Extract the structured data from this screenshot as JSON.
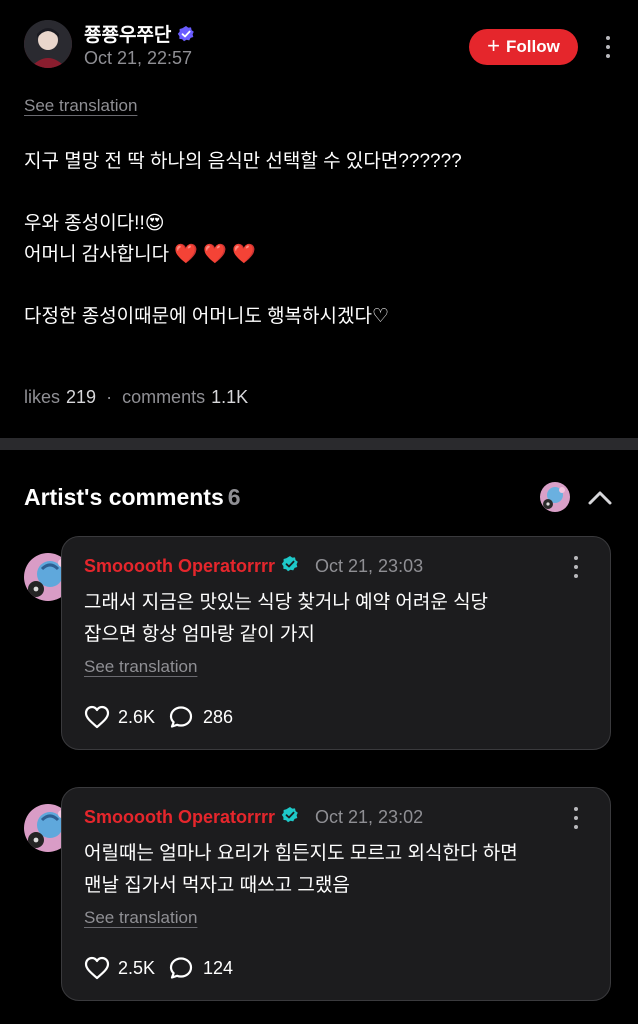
{
  "post": {
    "username": "쭁쭁우쭈단",
    "timestamp": "Oct 21, 22:57",
    "follow_label": "Follow",
    "see_translation": "See translation",
    "lines": [
      "지구 멸망 전 딱 하나의 음식만 선택할 수 있다면??????",
      "",
      "우와 종성이다!!😍",
      "어머니 감사합니다 ❤️ ❤️ ❤️",
      "",
      "다정한 종성이때문에 어머니도 행복하시겠다♡"
    ],
    "likes_label": "likes",
    "likes_count": "219",
    "separator": "·",
    "comments_label": "comments",
    "comments_count": "1.1K"
  },
  "artist_comments": {
    "title": "Artist's comments",
    "count": "6",
    "comments": [
      {
        "name": "Smooooth Operatorrrr",
        "time": "Oct 21, 23:03",
        "line1": "그래서 지금은 맛있는 식당 찾거나 예약 어려운 식당",
        "line2": "잡으면 항상 엄마랑 같이 가지",
        "see_translation": "See translation",
        "likes": "2.6K",
        "replies": "286"
      },
      {
        "name": "Smooooth Operatorrrr",
        "time": "Oct 21, 23:02",
        "line1": "어릴때는 얼마나 요리가 힘든지도 모르고 외식한다 하면",
        "line2": "맨날 집가서 먹자고 때쓰고 그랬음",
        "see_translation": "See translation",
        "likes": "2.5K",
        "replies": "124"
      }
    ]
  },
  "colors": {
    "accent_red": "#e5262c",
    "background": "#000000",
    "card": "#1c1c1e",
    "muted_text": "#8f8f94",
    "verified_purple": "#6a5cff",
    "verified_teal": "#1ec9c9"
  },
  "icons": [
    "verified-badge-icon",
    "plus-icon",
    "more-vertical-icon",
    "chevron-up-icon",
    "heart-outline-icon",
    "comment-bubble-icon"
  ]
}
